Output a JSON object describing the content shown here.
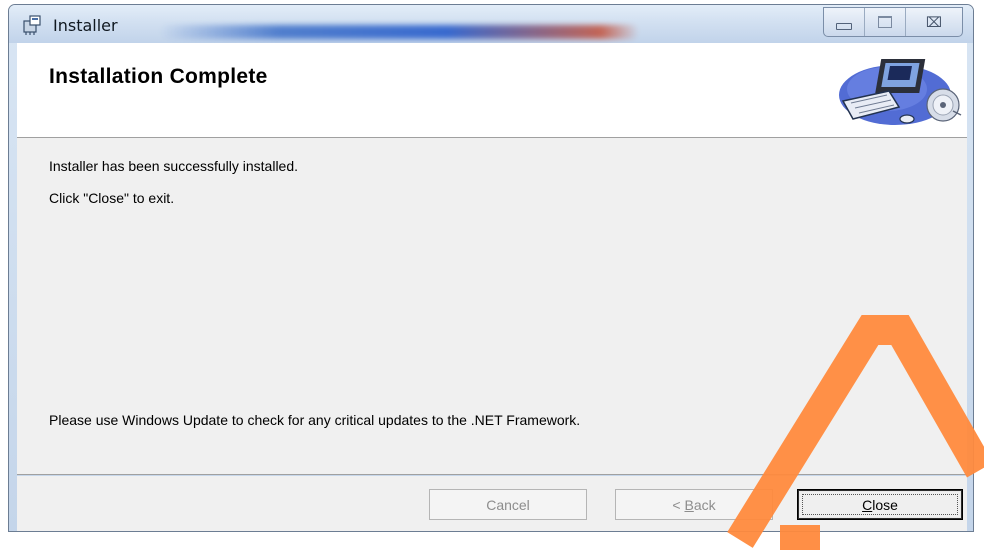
{
  "window": {
    "title": "Installer",
    "controls": [
      "minimize",
      "maximize",
      "close"
    ],
    "close_glyph": "⌧"
  },
  "header": {
    "title": "Installation Complete",
    "art_icon": "computer-cd-icon"
  },
  "content": {
    "line1": "Installer has been successfully installed.",
    "line2": "Click \"Close\" to exit.",
    "note": "Please use Windows Update to check for any critical updates to the .NET Framework."
  },
  "buttons": {
    "cancel": "Cancel",
    "back_prefix": "< ",
    "back_accel": "B",
    "back_rest": "ack",
    "close_accel": "C",
    "close_rest": "lose"
  },
  "colors": {
    "title_glow": "#1f56c9",
    "watermark": "#ff8a3d"
  }
}
